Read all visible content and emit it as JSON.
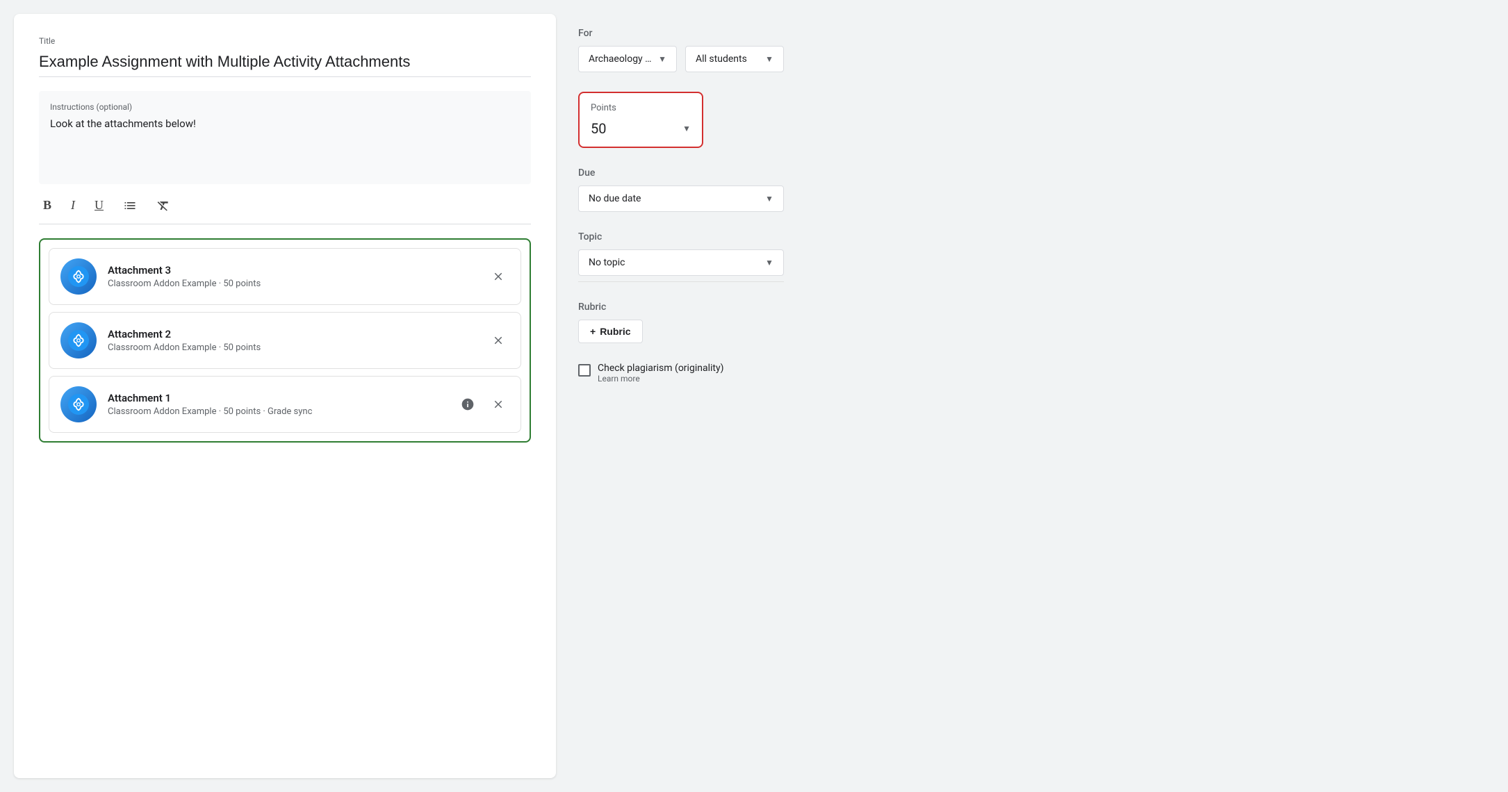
{
  "title_field": {
    "label": "Title",
    "value": "Example Assignment with Multiple Activity Attachments"
  },
  "instructions_field": {
    "label": "Instructions (optional)",
    "value": "Look at the attachments below!"
  },
  "toolbar": {
    "bold": "B",
    "italic": "I",
    "underline": "U"
  },
  "attachments": [
    {
      "id": 3,
      "name": "Attachment 3",
      "meta": "Classroom Addon Example · 50 points",
      "has_info": false
    },
    {
      "id": 2,
      "name": "Attachment 2",
      "meta": "Classroom Addon Example · 50 points",
      "has_info": false
    },
    {
      "id": 1,
      "name": "Attachment 1",
      "meta": "Classroom Addon Example · 50 points · Grade sync",
      "has_info": true
    }
  ],
  "sidebar": {
    "for_label": "For",
    "class_dropdown": "Archaeology ...",
    "students_dropdown": "All students",
    "points_label": "Points",
    "points_value": "50",
    "due_label": "Due",
    "due_value": "No due date",
    "topic_label": "Topic",
    "topic_value": "No topic",
    "rubric_label": "Rubric",
    "rubric_btn": "Rubric",
    "rubric_plus": "+",
    "plagiarism_label": "Check plagiarism (originality)",
    "learn_more": "Learn more"
  }
}
